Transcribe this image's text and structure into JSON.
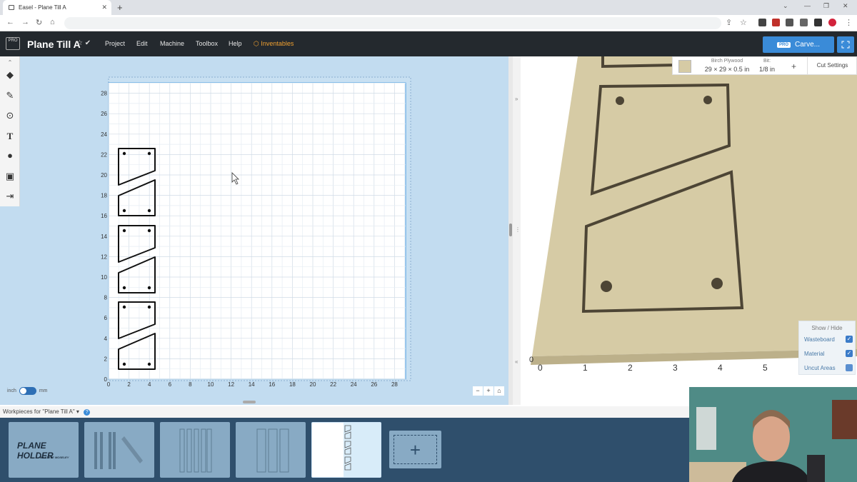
{
  "browser": {
    "tab_title": "Easel - Plane Till A",
    "new_tab": "+",
    "close_tab": "✕"
  },
  "header": {
    "logo_badge": "PRO",
    "project_title": "Plane Till A",
    "menus": [
      "Project",
      "Edit",
      "Machine",
      "Toolbox",
      "Help"
    ],
    "inventables_label": "Inventables",
    "carve_badge": "PRO",
    "carve_label": "Carve..."
  },
  "toolbar": {
    "tools": [
      "shapes-icon",
      "pen-icon",
      "target-icon",
      "text-icon",
      "apple-icon",
      "box-icon",
      "import-icon"
    ]
  },
  "canvas": {
    "y_ticks": [
      "0",
      "2",
      "4",
      "6",
      "8",
      "10",
      "12",
      "14",
      "16",
      "18",
      "20",
      "22",
      "24",
      "26",
      "28"
    ],
    "x_ticks": [
      "0",
      "2",
      "4",
      "6",
      "8",
      "10",
      "12",
      "14",
      "16",
      "18",
      "20",
      "22",
      "24",
      "26",
      "28"
    ],
    "unit_inch": "inch",
    "unit_mm": "mm",
    "zoom_out": "−",
    "zoom_in": "+",
    "home": "⌂"
  },
  "material": {
    "name": "Birch Plywood",
    "dimensions": "29 × 29 × 0.5 in",
    "bit_label": "Bit:",
    "bit_value": "1/8 in",
    "add_bit": "+",
    "cut_settings": "Cut Settings"
  },
  "preview": {
    "x_ticks": [
      "0",
      "1",
      "2",
      "3",
      "4",
      "5"
    ],
    "show_hide_title": "Show / Hide",
    "toggles": [
      {
        "label": "Wasteboard",
        "checked": true
      },
      {
        "label": "Material",
        "checked": true
      },
      {
        "label": "Uncut Areas",
        "checked": false
      }
    ]
  },
  "workpieces": {
    "label": "Workpieces for \"Plane Till A\" ▾",
    "help": "?",
    "thumb1_title": "PLANE HOLDER",
    "thumb1_sub": "BY STEVE MOSELEY",
    "add_label": "+"
  },
  "colors": {
    "header_bg": "#24292e",
    "accent_blue": "#3a8bd8",
    "canvas_bg": "#c2dcf0",
    "material": "#d6cba5",
    "inventables": "#f0a030"
  }
}
